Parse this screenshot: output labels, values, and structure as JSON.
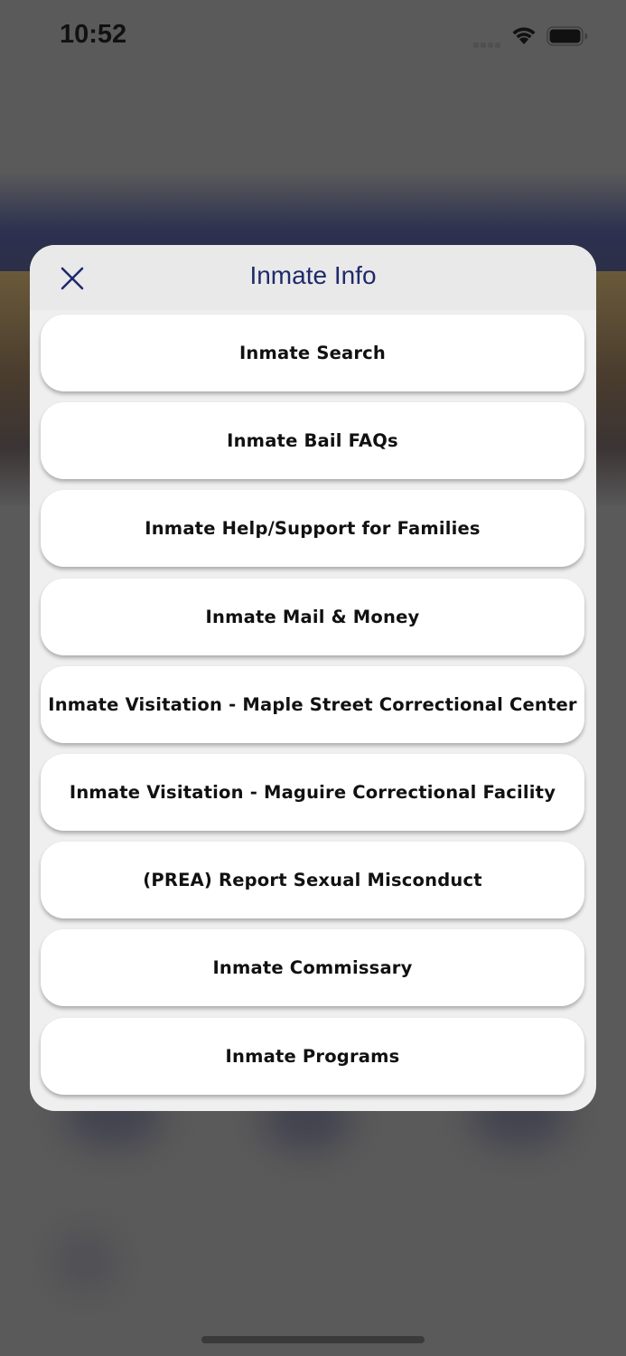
{
  "status_bar": {
    "time": "10:52"
  },
  "modal": {
    "title": "Inmate Info",
    "close_icon": "close-icon"
  },
  "menu": {
    "items": [
      {
        "label": "Inmate Search"
      },
      {
        "label": "Inmate Bail FAQs"
      },
      {
        "label": "Inmate Help/Support for Families"
      },
      {
        "label": "Inmate Mail & Money"
      },
      {
        "label": "Inmate Visitation - Maple Street Correctional Center"
      },
      {
        "label": "Inmate Visitation - Maguire Correctional Facility"
      },
      {
        "label": "(PREA) Report Sexual Misconduct"
      },
      {
        "label": "Inmate Commissary"
      },
      {
        "label": "Inmate Programs"
      }
    ]
  },
  "colors": {
    "title": "#1f2a6b",
    "overlay": "#5a5a5a",
    "card": "#ffffff",
    "modal_bg": "#efefef"
  }
}
